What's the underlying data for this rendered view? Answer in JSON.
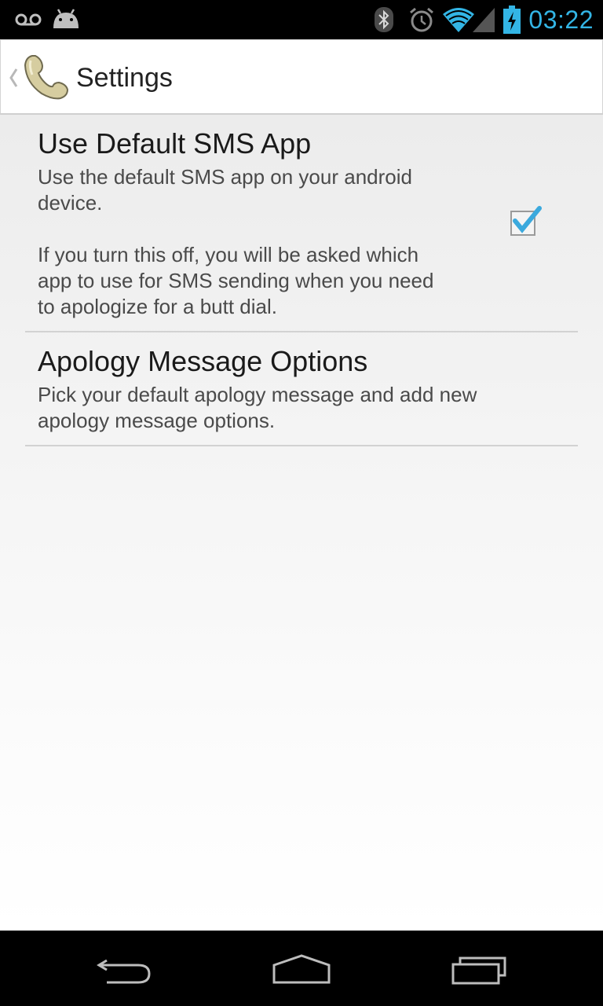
{
  "status_bar": {
    "time": "03:22",
    "clock_color": "#33b5e5",
    "icons": [
      "voicemail-icon",
      "android-icon",
      "bluetooth-icon",
      "alarm-icon",
      "wifi-icon",
      "signal-icon",
      "battery-charging-icon"
    ]
  },
  "action_bar": {
    "title": "Settings",
    "app_icon": "phone-handset-icon"
  },
  "preferences": [
    {
      "title": "Use Default SMS App",
      "summary": "Use the default SMS app on your android\ndevice.\n\nIf you turn this off, you will be asked which\napp to use for SMS sending when you need\nto apologize for a butt dial.",
      "checked": true
    },
    {
      "title": "Apology Message Options",
      "summary": "Pick your default apology message and add new\napology message options."
    }
  ],
  "nav_bar": {
    "buttons": [
      "back-icon",
      "home-icon",
      "recent-apps-icon"
    ]
  },
  "colors": {
    "accent": "#33b5e5",
    "checkmark": "#3ba9dd",
    "app_icon": "#d6cda0"
  }
}
